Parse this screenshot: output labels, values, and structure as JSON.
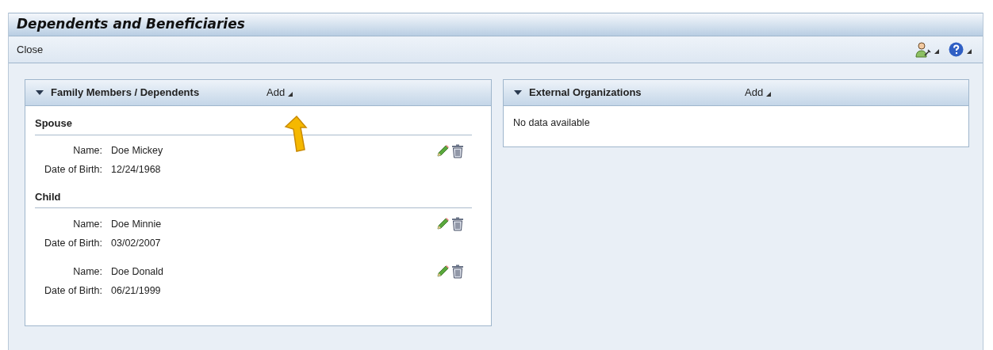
{
  "window": {
    "title": "Dependents and Beneficiaries"
  },
  "toolbar": {
    "buttons": [
      "Close"
    ]
  },
  "panels": [
    {
      "title": "Family Members / Dependents",
      "expanded": true,
      "add_label": "Add",
      "groups": [
        {
          "heading": "Spouse",
          "entries": [
            {
              "fields": [
                {
                  "label": "Name:",
                  "value": "Doe Mickey"
                },
                {
                  "label": "Date of Birth:",
                  "value": "12/24/1968"
                }
              ]
            }
          ]
        },
        {
          "heading": "Child",
          "entries": [
            {
              "fields": [
                {
                  "label": "Name:",
                  "value": "Doe Minnie"
                },
                {
                  "label": "Date of Birth:",
                  "value": "03/02/2007"
                }
              ]
            },
            {
              "fields": [
                {
                  "label": "Name:",
                  "value": "Doe Donald"
                },
                {
                  "label": "Date of Birth:",
                  "value": "06/21/1999"
                }
              ]
            }
          ]
        }
      ]
    },
    {
      "title": "External Organizations",
      "expanded": true,
      "add_label": "Add",
      "empty_text": "No data available"
    }
  ]
}
